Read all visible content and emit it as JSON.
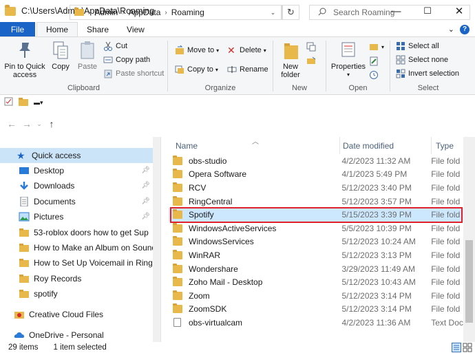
{
  "window": {
    "title": "C:\\Users\\Admin\\AppData\\Roaming",
    "minimize": "—",
    "maximize": "☐",
    "close": "✕"
  },
  "tabs": {
    "file": "File",
    "home": "Home",
    "share": "Share",
    "view": "View"
  },
  "ribbon": {
    "clipboard": {
      "label": "Clipboard",
      "pin": "Pin to Quick access",
      "copy": "Copy",
      "paste": "Paste",
      "cut": "Cut",
      "copy_path": "Copy path",
      "paste_shortcut": "Paste shortcut"
    },
    "organize": {
      "label": "Organize",
      "move_to": "Move to",
      "copy_to": "Copy to",
      "delete": "Delete",
      "rename": "Rename"
    },
    "new": {
      "label": "New",
      "new_folder": "New folder"
    },
    "open": {
      "label": "Open",
      "properties": "Properties"
    },
    "select": {
      "label": "Select",
      "select_all": "Select all",
      "select_none": "Select none",
      "invert": "Invert selection"
    }
  },
  "address": {
    "crumbs": [
      "Admin",
      "AppData",
      "Roaming"
    ],
    "search_placeholder": "Search Roaming"
  },
  "nav": {
    "quick_access": "Quick access",
    "items": [
      "Desktop",
      "Downloads",
      "Documents",
      "Pictures",
      "53-roblox doors how to get Sup",
      "How to Make an Album on SoundC",
      "How to Set Up Voicemail in RingCe",
      "Roy Records",
      "spotify"
    ],
    "creative_cloud": "Creative Cloud Files",
    "onedrive": "OneDrive - Personal"
  },
  "columns": {
    "name": "Name",
    "date": "Date modified",
    "type": "Type"
  },
  "files": [
    {
      "name": "obs-studio",
      "date": "4/2/2023 11:32 AM",
      "type": "File fold"
    },
    {
      "name": "Opera Software",
      "date": "4/1/2023 5:49 PM",
      "type": "File fold"
    },
    {
      "name": "RCV",
      "date": "5/12/2023 3:40 PM",
      "type": "File fold"
    },
    {
      "name": "RingCentral",
      "date": "5/12/2023 3:57 PM",
      "type": "File fold"
    },
    {
      "name": "Spotify",
      "date": "5/15/2023 3:39 PM",
      "type": "File fold"
    },
    {
      "name": "WindowsActiveServices",
      "date": "5/5/2023 10:39 PM",
      "type": "File fold"
    },
    {
      "name": "WindowsServices",
      "date": "5/12/2023 10:24 AM",
      "type": "File fold"
    },
    {
      "name": "WinRAR",
      "date": "5/12/2023 3:13 PM",
      "type": "File fold"
    },
    {
      "name": "Wondershare",
      "date": "3/29/2023 11:49 AM",
      "type": "File fold"
    },
    {
      "name": "Zoho Mail - Desktop",
      "date": "5/12/2023 10:43 AM",
      "type": "File fold"
    },
    {
      "name": "Zoom",
      "date": "5/12/2023 3:14 PM",
      "type": "File fold"
    },
    {
      "name": "ZoomSDK",
      "date": "5/12/2023 3:14 PM",
      "type": "File fold"
    },
    {
      "name": "obs-virtualcam",
      "date": "4/2/2023 11:36 AM",
      "type": "Text Doc"
    }
  ],
  "status": {
    "items": "29 items",
    "selected": "1 item selected"
  },
  "colors": {
    "accent": "#1a64c8",
    "folder": "#e8b84a",
    "selection": "#cce8ff",
    "highlight_box": "#e0202a"
  }
}
